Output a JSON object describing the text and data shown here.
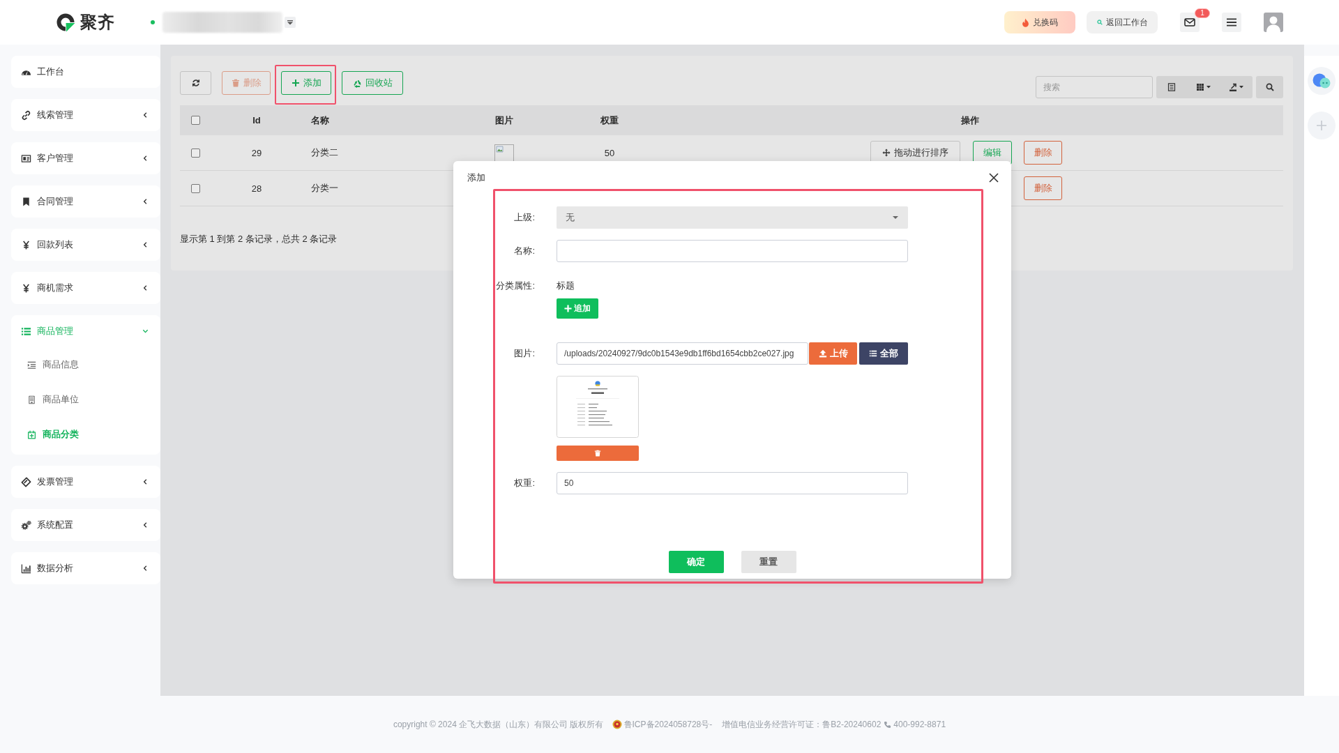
{
  "header": {
    "logo_text": "聚齐",
    "actions": [
      {
        "label": "兑换码",
        "kind": "promo"
      },
      {
        "label": "返回工作台",
        "kind": "back"
      }
    ],
    "mail_badge": "1"
  },
  "sidebar": {
    "items": [
      {
        "label": "工作台",
        "kind": "link",
        "selected": false
      },
      {
        "label": "线索管理",
        "kind": "group",
        "selected": false,
        "expanded": false
      },
      {
        "label": "客户管理",
        "kind": "group",
        "selected": false,
        "expanded": false
      },
      {
        "label": "合同管理",
        "kind": "group",
        "selected": false,
        "expanded": false
      },
      {
        "label": "回款列表",
        "kind": "group",
        "selected": false,
        "expanded": false
      },
      {
        "label": "商机需求",
        "kind": "group",
        "selected": false,
        "expanded": false
      },
      {
        "label": "商品管理",
        "kind": "group",
        "selected": true,
        "expanded": true,
        "children": [
          {
            "label": "商品信息",
            "selected": false
          },
          {
            "label": "商品单位",
            "selected": false
          },
          {
            "label": "商品分类",
            "selected": true
          }
        ]
      },
      {
        "label": "发票管理",
        "kind": "group",
        "selected": false,
        "expanded": false
      },
      {
        "label": "系统配置",
        "kind": "group",
        "selected": false,
        "expanded": false
      },
      {
        "label": "数据分析",
        "kind": "group",
        "selected": false,
        "expanded": false
      }
    ]
  },
  "toolbar": {
    "buttons": [
      {
        "kind": "refresh",
        "disabled": false,
        "highlighted": false
      },
      {
        "label": "删除",
        "kind": "delete",
        "disabled": true,
        "highlighted": false
      },
      {
        "label": "添加",
        "kind": "add",
        "disabled": false,
        "highlighted": true
      },
      {
        "label": "回收站",
        "kind": "recycle",
        "disabled": false,
        "highlighted": false
      }
    ],
    "search": {
      "placeholder": "搜索"
    }
  },
  "table": {
    "header_checked": false,
    "columns": [
      "Id",
      "名称",
      "图片",
      "权重",
      "操作"
    ],
    "rows": [
      {
        "checked": false,
        "id": "29",
        "name": "分类二",
        "image": true,
        "weight": "50",
        "actions": [
          {
            "label": "拖动进行排序",
            "kind": "drag"
          },
          {
            "label": "编辑",
            "kind": "edit"
          },
          {
            "label": "删除",
            "kind": "delete"
          }
        ]
      },
      {
        "checked": false,
        "id": "28",
        "name": "分类一",
        "actions": [
          {
            "label": "删除",
            "kind": "delete"
          }
        ]
      }
    ],
    "summary": "显示第 1 到第 2 条记录，总共 2 条记录"
  },
  "modal": {
    "title": "添加",
    "highlighted": true,
    "fields": [
      {
        "label": "上级:",
        "kind": "select",
        "value": "无"
      },
      {
        "label": "名称:",
        "kind": "text"
      },
      {
        "label": "分类属性:",
        "kind": "attributes",
        "items": [
          "标题"
        ],
        "button": "追加"
      },
      {
        "label": "图片:",
        "kind": "upload",
        "value": "/uploads/20240927/9dc0b1543e9db1ff6bd1654cbb2ce027.jpg",
        "buttons": [
          {
            "label": "上传",
            "kind": "upload"
          },
          {
            "label": "全部",
            "kind": "choose"
          }
        ],
        "preview": true
      },
      {
        "label": "权重:",
        "kind": "text",
        "value": "50"
      }
    ],
    "buttons": [
      {
        "label": "确定",
        "kind": "primary"
      },
      {
        "label": "重置",
        "kind": "reset"
      }
    ]
  },
  "footer": {
    "copyright": "copyright © 2024 企飞大数据（山东）有限公司 版权所有",
    "icp": "鲁ICP备2024058728号-",
    "license": "增值电信业务经营许可证：鲁B2-20240602",
    "phone": "400-992-8871"
  }
}
